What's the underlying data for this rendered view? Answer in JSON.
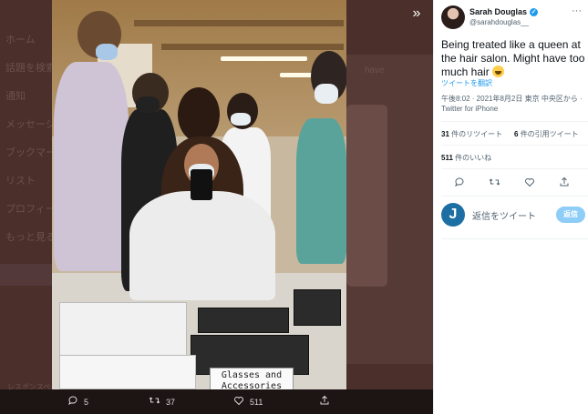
{
  "background": {
    "nav": [
      "ホーム",
      "話題を検索",
      "通知",
      "メッセージ",
      "ブックマーク",
      "リスト",
      "プロフィール",
      "もっと見る"
    ],
    "right_text": "have",
    "footer": "レスポンスページ"
  },
  "media": {
    "sign_text": "Glasses and Accessories",
    "actions": {
      "reply_count": "5",
      "retweet_count": "37",
      "like_count": "511"
    }
  },
  "tweet": {
    "author_name": "Sarah Douglas",
    "author_handle": "@sarahdouglas__",
    "text": "Being treated like a queen at the hair salon. Might have too much hair",
    "translate_label": "ツイートを翻訳",
    "meta": "午後8:02 · 2021年8月2日 東京 中央区から · Twitter for iPhone",
    "retweets_count": "31",
    "retweets_label": "件のリツイート",
    "quotes_count": "6",
    "quotes_label": "件の引用ツイート",
    "likes_count": "511",
    "likes_label": "件のいいね"
  },
  "reply": {
    "avatar_letter": "J",
    "placeholder": "返信をツイート",
    "button_label": "返信"
  },
  "colors": {
    "accent": "#1d9bf0",
    "reply_button": "#8ecdf7",
    "backdrop": "#4a2f2b"
  }
}
